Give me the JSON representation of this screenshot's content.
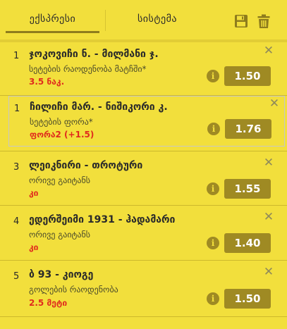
{
  "tabs": {
    "express": "ექსპრესი",
    "system": "სისტემა"
  },
  "colors": {
    "accent": "#f2df3c",
    "odds_bg": "#9f8a23",
    "pick": "#e02b1d"
  },
  "toolbar": {
    "save_icon": "floppy-disk-icon",
    "delete_icon": "trash-can-icon"
  },
  "bets": [
    {
      "n": "1",
      "match": "ჯოკოვიჩი ნ. - მილმანი ჯ.",
      "market": "სეტების რაოდენობა მატჩში*",
      "pick": "3.5 ნაკ.",
      "odds": "1.50"
    },
    {
      "n": "1",
      "match": "ჩილიჩი მარ. - ნიშიკორი კ.",
      "market": "სეტების ფორა*",
      "pick": "ფორა2 (+1.5)",
      "odds": "1.76"
    },
    {
      "n": "3",
      "match": "ლეიკნირი - თროტური",
      "market": "ორივე გაიტანს",
      "pick": "კი",
      "odds": "1.55"
    },
    {
      "n": "4",
      "match": "ედერშეიმი 1931 - ჰადამარი",
      "market": "ორივე გაიტანს",
      "pick": "კი",
      "odds": "1.40"
    },
    {
      "n": "5",
      "match": "ბ 93 - კიოგე",
      "market": "გოლების რაოდენობა",
      "pick": "2.5 მეტი",
      "odds": "1.50"
    }
  ]
}
